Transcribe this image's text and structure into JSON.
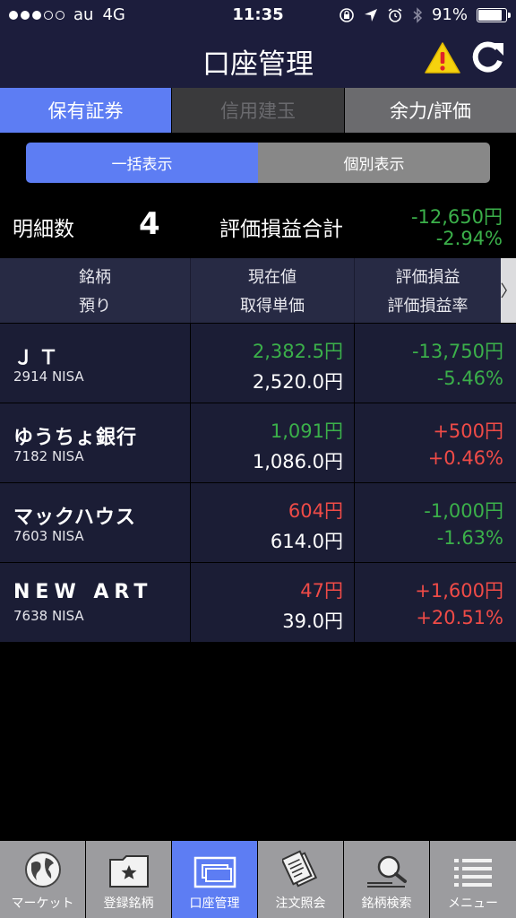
{
  "status": {
    "carrier": "au",
    "network": "4G",
    "time": "11:35",
    "battery": "91%",
    "battery_level": 0.91
  },
  "nav": {
    "title": "口座管理"
  },
  "tabs": [
    {
      "label": "保有証券",
      "state": "active"
    },
    {
      "label": "信用建玉",
      "state": "disabled"
    },
    {
      "label": "余力/評価",
      "state": "inactive"
    }
  ],
  "segment": [
    {
      "label": "一括表示",
      "state": "selected"
    },
    {
      "label": "個別表示",
      "state": "unselected"
    }
  ],
  "summary": {
    "count_label": "明細数",
    "count": "4",
    "total_label": "評価損益合計",
    "total_amount": "-12,650円",
    "total_rate": "-2.94%"
  },
  "table": {
    "headers": [
      {
        "line1": "銘柄",
        "line2": "預り"
      },
      {
        "line1": "現在値",
        "line2": "取得単価"
      },
      {
        "line1": "評価損益",
        "line2": "評価損益率"
      }
    ],
    "more_glyph": "〉",
    "rows": [
      {
        "name": "ＪＴ",
        "code": "2914 NISA",
        "current": "2,382.5円",
        "acquired": "2,520.0円",
        "pl": "-13,750円",
        "pl_rate": "-5.46%"
      },
      {
        "name": "ゆうちょ銀行",
        "code": "7182 NISA",
        "current": "1,091円",
        "acquired": "1,086.0円",
        "pl": "+500円",
        "pl_rate": "+0.46%"
      },
      {
        "name": "マックハウス",
        "code": "7603 NISA",
        "current": "604円",
        "acquired": "614.0円",
        "pl": "-1,000円",
        "pl_rate": "-1.63%"
      },
      {
        "name": "NEW ART",
        "code": "7638 NISA",
        "current": "47円",
        "acquired": "39.0円",
        "pl": "+1,600円",
        "pl_rate": "+20.51%"
      }
    ]
  },
  "tabbar": [
    {
      "label": "マーケット",
      "icon": "globe-icon"
    },
    {
      "label": "登録銘柄",
      "icon": "folder-star-icon"
    },
    {
      "label": "口座管理",
      "icon": "account-cards-icon",
      "active": true
    },
    {
      "label": "注文照会",
      "icon": "documents-icon"
    },
    {
      "label": "銘柄検索",
      "icon": "search-icon"
    },
    {
      "label": "メニュー",
      "icon": "menu-icon"
    }
  ],
  "colors": {
    "bar": "#1c1d3c",
    "accent": "#5d7df3",
    "gain": "#ef4b47",
    "loss": "#3bb04a"
  }
}
